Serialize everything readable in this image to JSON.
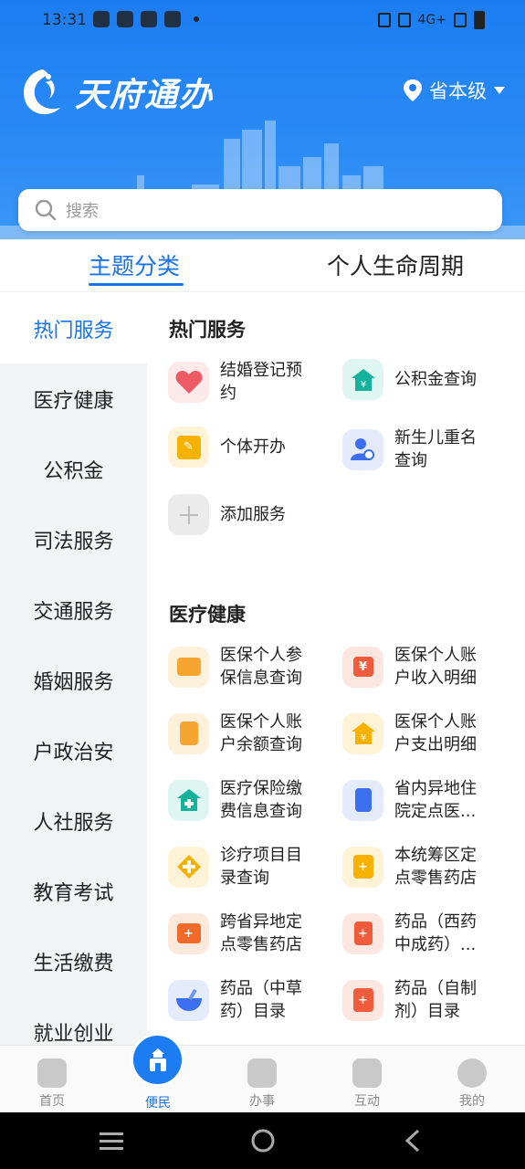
{
  "status": {
    "time": "13:31",
    "network": "4G+"
  },
  "header": {
    "app_title": "天府通办",
    "location": "省本级"
  },
  "search": {
    "placeholder": "搜索"
  },
  "tabs": [
    {
      "label": "主题分类",
      "active": true
    },
    {
      "label": "个人生命周期",
      "active": false
    }
  ],
  "sidebar": {
    "items": [
      {
        "label": "热门服务",
        "active": true
      },
      {
        "label": "医疗健康"
      },
      {
        "label": "公积金"
      },
      {
        "label": "司法服务"
      },
      {
        "label": "交通服务"
      },
      {
        "label": "婚姻服务"
      },
      {
        "label": "户政治安"
      },
      {
        "label": "人社服务"
      },
      {
        "label": "教育考试"
      },
      {
        "label": "生活缴费"
      },
      {
        "label": "就业创业"
      }
    ]
  },
  "sections": {
    "hot": {
      "title": "热门服务",
      "items": [
        {
          "label": "结婚登记预约",
          "icon": "heart-icon",
          "color": "#ef5a67"
        },
        {
          "label": "公积金查询",
          "icon": "house-yuan-icon",
          "color": "#14b29a"
        },
        {
          "label": "个体开办",
          "icon": "document-edit-icon",
          "color": "#f7b200"
        },
        {
          "label": "新生儿重名查询",
          "icon": "person-search-icon",
          "color": "#3b6ff0"
        },
        {
          "label": "添加服务",
          "icon": "plus-icon",
          "color": "#cfcfcf"
        }
      ]
    },
    "medical": {
      "title": "医疗健康",
      "items": [
        {
          "label": "医保个人参保信息查询",
          "icon": "card-icon",
          "color": "#f6a531"
        },
        {
          "label": "医保个人账户收入明细",
          "icon": "yuan-doc-icon",
          "color": "#ef5b3b"
        },
        {
          "label": "医保个人账户余额查询",
          "icon": "id-card-icon",
          "color": "#f6a531"
        },
        {
          "label": "医保个人账户支出明细",
          "icon": "house-yuan-icon",
          "color": "#f7b200"
        },
        {
          "label": "医疗保险缴费信息查询",
          "icon": "hospital-icon",
          "color": "#14b29a"
        },
        {
          "label": "省内异地住院定点医...",
          "icon": "building-icon",
          "color": "#3b6ff0"
        },
        {
          "label": "诊疗项目目录查询",
          "icon": "medical-cross-icon",
          "color": "#f7b200"
        },
        {
          "label": "本统筹区定点零售药店",
          "icon": "pharmacy-icon",
          "color": "#f7b200"
        },
        {
          "label": "跨省异地定点零售药店",
          "icon": "store-icon",
          "color": "#f26a2a"
        },
        {
          "label": "药品（西药中成药）...",
          "icon": "medicine-bottle-icon",
          "color": "#ef5b3b"
        },
        {
          "label": "药品（中草药）目录",
          "icon": "mortar-icon",
          "color": "#3b6ff0"
        },
        {
          "label": "药品（自制剂）目录",
          "icon": "medicine-jar-icon",
          "color": "#ef5b3b"
        }
      ]
    }
  },
  "bottomnav": {
    "items": [
      {
        "label": "首页"
      },
      {
        "label": "便民",
        "active": true
      },
      {
        "label": "办事"
      },
      {
        "label": "互动"
      },
      {
        "label": "我的"
      }
    ]
  }
}
